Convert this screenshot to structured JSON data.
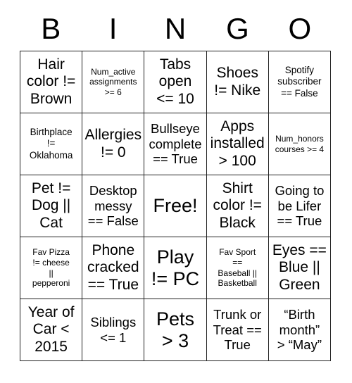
{
  "card": {
    "header": {
      "letters": [
        "B",
        "I",
        "N",
        "G",
        "O"
      ]
    },
    "rows": [
      {
        "cells": [
          {
            "text": "Hair\ncolor !=\nBrown",
            "size": "lg"
          },
          {
            "text": "Num_active\nassignments\n>= 6",
            "size": "xs"
          },
          {
            "text": "Tabs\nopen\n<= 10",
            "size": "lg"
          },
          {
            "text": "Shoes\n!= Nike",
            "size": "lg"
          },
          {
            "text": "Spotify\nsubscriber\n== False",
            "size": "sm"
          }
        ]
      },
      {
        "cells": [
          {
            "text": "Birthplace\n!=\nOklahoma",
            "size": "sm"
          },
          {
            "text": "Allergies\n!= 0",
            "size": "lg"
          },
          {
            "text": "Bullseye\ncomplete\n== True",
            "size": "md"
          },
          {
            "text": "Apps\ninstalled\n> 100",
            "size": "lg"
          },
          {
            "text": "Num_honors\ncourses >= 4",
            "size": "xs"
          }
        ]
      },
      {
        "cells": [
          {
            "text": "Pet !=\nDog ||\nCat",
            "size": "lg"
          },
          {
            "text": "Desktop\nmessy\n== False",
            "size": "md"
          },
          {
            "text": "Free!",
            "size": "xl"
          },
          {
            "text": "Shirt\ncolor !=\nBlack",
            "size": "lg"
          },
          {
            "text": "Going to\nbe Lifer\n== True",
            "size": "md"
          }
        ]
      },
      {
        "cells": [
          {
            "text": "Fav Pizza\n!= cheese\n||\npepperoni",
            "size": "xs"
          },
          {
            "text": "Phone\ncracked\n== True",
            "size": "lg"
          },
          {
            "text": "Play\n!= PC",
            "size": "xl"
          },
          {
            "text": "Fav Sport\n==\nBaseball ||\nBasketball",
            "size": "xs"
          },
          {
            "text": "Eyes ==\nBlue ||\nGreen",
            "size": "lg"
          }
        ]
      },
      {
        "cells": [
          {
            "text": "Year of\nCar <\n2015",
            "size": "lg"
          },
          {
            "text": "Siblings\n<= 1",
            "size": "md"
          },
          {
            "text": "Pets\n> 3",
            "size": "xl"
          },
          {
            "text": "Trunk or\nTreat ==\nTrue",
            "size": "md"
          },
          {
            "text": "“Birth\nmonth”\n> “May”",
            "size": "md"
          }
        ]
      }
    ]
  }
}
